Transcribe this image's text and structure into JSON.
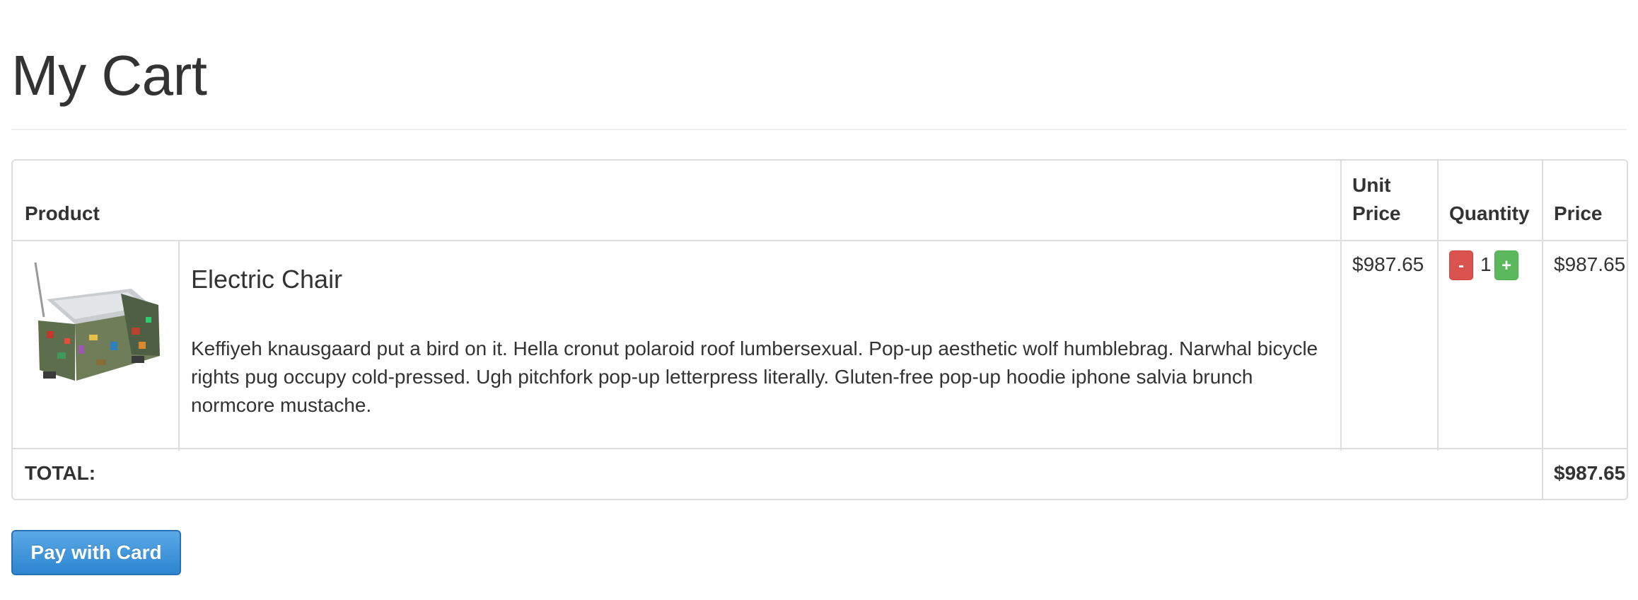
{
  "page": {
    "title": "My Cart"
  },
  "table": {
    "headers": {
      "product": "Product",
      "unit_price_line1": "Unit",
      "unit_price_line2": "Price",
      "quantity": "Quantity",
      "price": "Price"
    },
    "rows": [
      {
        "image_icon": "electric-chair-image",
        "name": "Electric Chair",
        "description": "Keffiyeh knausgaard put a bird on it. Hella cronut polaroid roof lumbersexual. Pop-up aesthetic wolf humblebrag. Narwhal bicycle rights pug occupy cold-pressed. Ugh pitchfork pop-up letterpress literally. Gluten-free pop-up hoodie iphone salvia brunch normcore mustache.",
        "unit_price": "$987.65",
        "quantity": "1",
        "decrement_label": "-",
        "increment_label": "+",
        "price": "$987.65"
      }
    ],
    "total_label": "TOTAL:",
    "total_value": "$987.65"
  },
  "actions": {
    "pay_label": "Pay with Card"
  },
  "colors": {
    "decrement": "#d9534f",
    "increment": "#5cb85c",
    "pay_button": "#3a8fd9",
    "border": "#dddddd"
  }
}
